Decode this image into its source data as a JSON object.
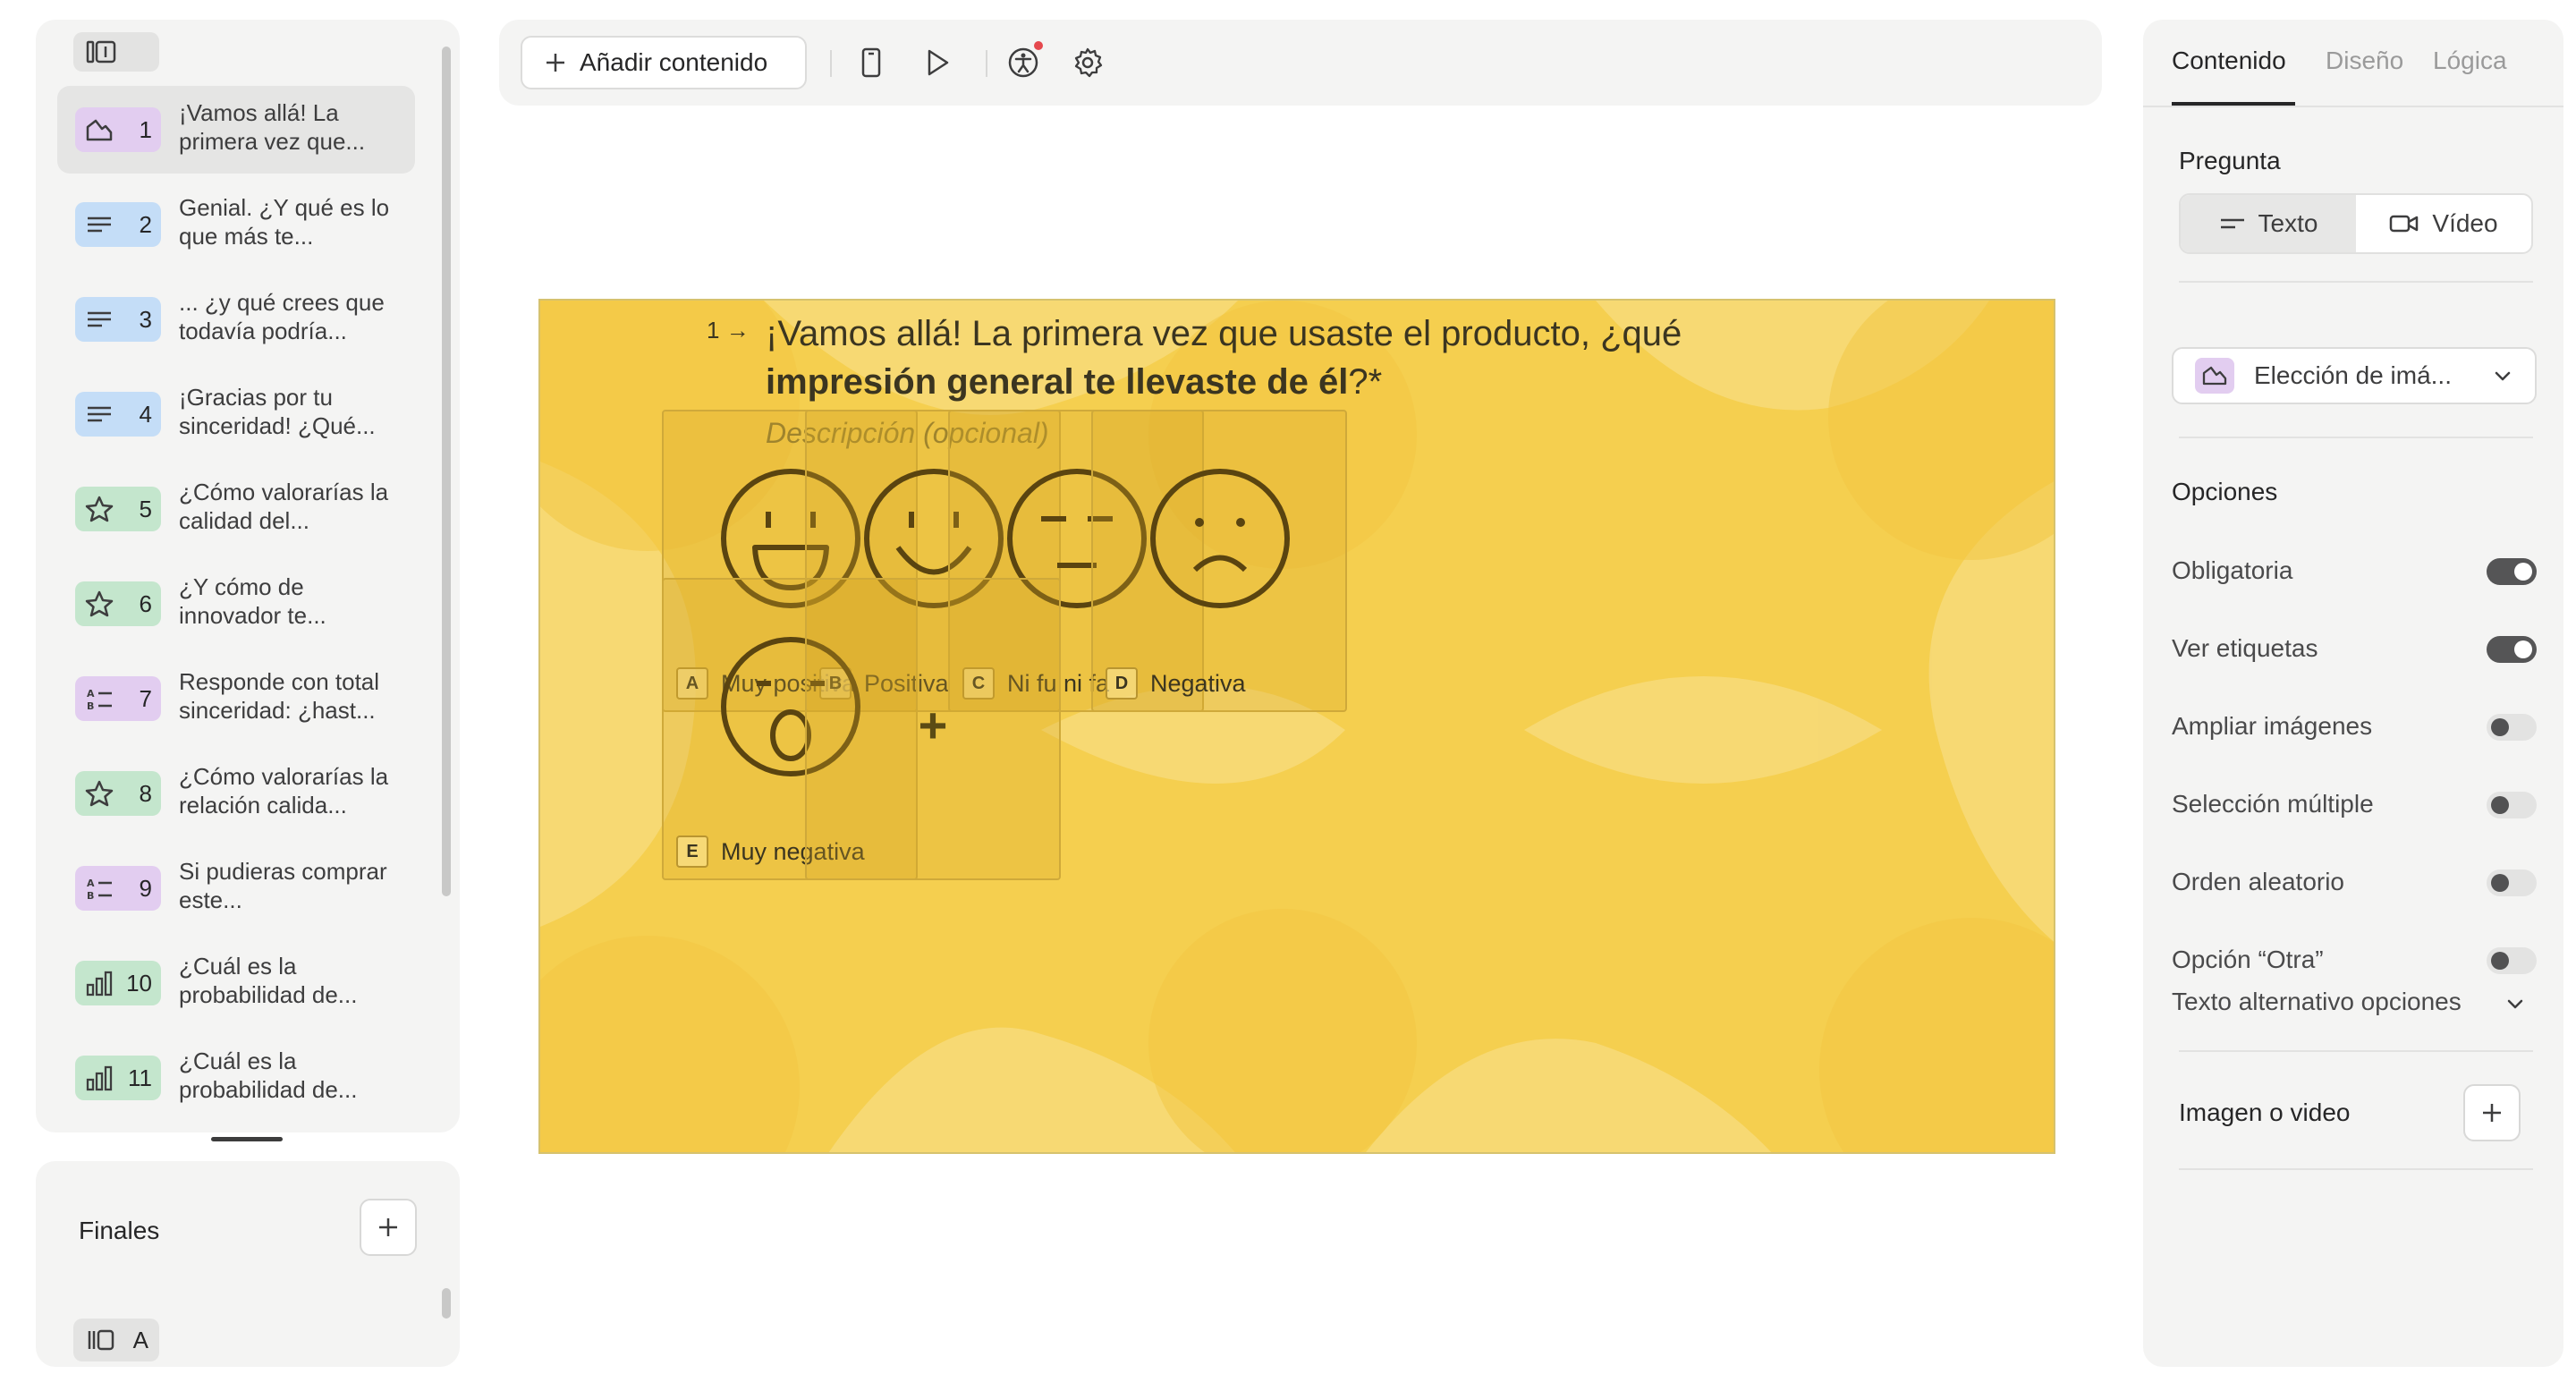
{
  "sidebar": {
    "questions": [
      {
        "num": "1",
        "text": "¡Vamos allá! La primera vez que...",
        "type_icon": "image-choice-icon",
        "color": "#e2cdf0"
      },
      {
        "num": "2",
        "text": "Genial. ¿Y qué es lo que más te...",
        "type_icon": "long-text-icon",
        "color": "#c4ddf7"
      },
      {
        "num": "3",
        "text": "... ¿y qué crees que todavía podría...",
        "type_icon": "long-text-icon",
        "color": "#c4ddf7"
      },
      {
        "num": "4",
        "text": "¡Gracias por tu sinceridad! ¿Qué...",
        "type_icon": "long-text-icon",
        "color": "#c4ddf7"
      },
      {
        "num": "5",
        "text": "¿Cómo valorarías la calidad del...",
        "type_icon": "star-rating-icon",
        "color": "#c4e6cd"
      },
      {
        "num": "6",
        "text": "¿Y cómo de innovador te...",
        "type_icon": "star-rating-icon",
        "color": "#c4e6cd"
      },
      {
        "num": "7",
        "text": "Responde con total sinceridad: ¿hast...",
        "type_icon": "multiple-choice-icon",
        "color": "#e2cdf0"
      },
      {
        "num": "8",
        "text": "¿Cómo valorarías la relación calida...",
        "type_icon": "star-rating-icon",
        "color": "#c4e6cd"
      },
      {
        "num": "9",
        "text": "Si pudieras comprar este...",
        "type_icon": "multiple-choice-icon",
        "color": "#e2cdf0"
      },
      {
        "num": "10",
        "text": "¿Cuál es la probabilidad de...",
        "type_icon": "nps-bar-icon",
        "color": "#c4e6cd"
      },
      {
        "num": "11",
        "text": "¿Cuál es la probabilidad de...",
        "type_icon": "nps-bar-icon",
        "color": "#c4e6cd"
      }
    ],
    "finales_title": "Finales",
    "finales_item": "A"
  },
  "toolbar": {
    "add_content_label": "Añadir contenido"
  },
  "question": {
    "index": "1",
    "title_plain_1": "¡Vamos allá! La primera vez que usaste el producto, ¿qué",
    "title_bold": "impresión general te llevaste de él",
    "title_plain_2": "?*",
    "description_placeholder": "Descripción (opcional)",
    "choices": [
      {
        "key": "A",
        "label": "Muy positiva",
        "icon": "big-smile-icon"
      },
      {
        "key": "B",
        "label": "Positiva",
        "icon": "smile-icon"
      },
      {
        "key": "C",
        "label": "Ni fu ni fa",
        "icon": "neutral-face-icon"
      },
      {
        "key": "D",
        "label": "Negativa",
        "icon": "sad-face-icon"
      },
      {
        "key": "E",
        "label": "Muy negativa",
        "icon": "shocked-face-icon"
      }
    ],
    "add_choice_symbol": "+"
  },
  "right_panel": {
    "tabs": [
      "Contenido",
      "Diseño",
      "Lógica"
    ],
    "active_tab": "Contenido",
    "pregunta_label": "Pregunta",
    "segment": {
      "texto": "Texto",
      "video": "Vídeo",
      "selected": "Texto"
    },
    "question_type": "Elección de imá...",
    "opciones_title": "Opciones",
    "options": [
      {
        "label": "Obligatoria",
        "on": true
      },
      {
        "label": "Ver etiquetas",
        "on": true
      },
      {
        "label": "Ampliar imágenes",
        "on": false
      },
      {
        "label": "Selección múltiple",
        "on": false
      },
      {
        "label": "Orden aleatorio",
        "on": false
      },
      {
        "label": "Opción “Otra”",
        "on": false
      }
    ],
    "alt_text_label": "Texto alternativo opciones",
    "media_label": "Imagen o video"
  },
  "colors": {
    "canvas_bg": "#f5cf4f",
    "accent_dark": "#262627",
    "notification": "#e5484d"
  }
}
